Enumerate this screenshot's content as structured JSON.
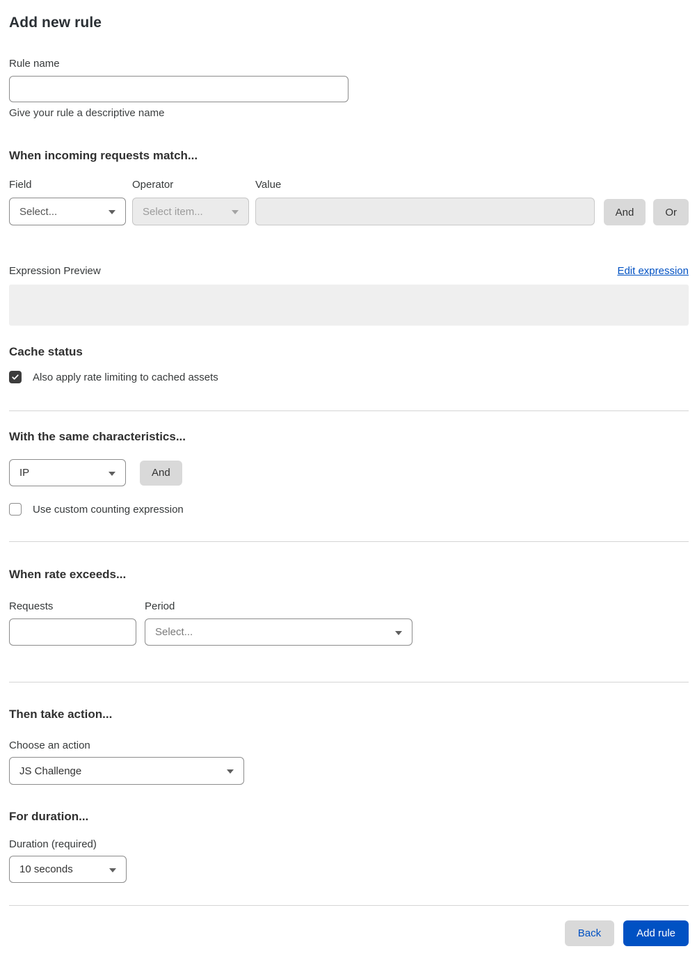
{
  "page": {
    "title": "Add new rule"
  },
  "rule_name": {
    "label": "Rule name",
    "value": "",
    "helper": "Give your rule a descriptive name"
  },
  "match_section": {
    "heading": "When incoming requests match...",
    "field": {
      "label": "Field",
      "selected": "Select..."
    },
    "operator": {
      "label": "Operator",
      "selected": "Select item...",
      "disabled": true
    },
    "value": {
      "label": "Value",
      "value": "",
      "disabled": true
    },
    "and_button": "And",
    "or_button": "Or"
  },
  "expression": {
    "preview_label": "Expression Preview",
    "edit_link": "Edit expression",
    "preview_value": ""
  },
  "cache_status": {
    "heading": "Cache status",
    "checkbox_label": "Also apply rate limiting to cached assets",
    "checked": true
  },
  "characteristics": {
    "heading": "With the same characteristics...",
    "select_value": "IP",
    "and_button": "And",
    "checkbox_label": "Use custom counting expression",
    "checked": false
  },
  "rate": {
    "heading": "When rate exceeds...",
    "requests": {
      "label": "Requests",
      "value": ""
    },
    "period": {
      "label": "Period",
      "selected": "Select..."
    }
  },
  "action": {
    "heading": "Then take action...",
    "label": "Choose an action",
    "selected": "JS Challenge"
  },
  "duration": {
    "heading": "For duration...",
    "label": "Duration (required)",
    "selected": "10 seconds"
  },
  "footer": {
    "back_button": "Back",
    "add_rule_button": "Add rule"
  },
  "icons": {
    "dropdown_caret": "chevron-down",
    "checkmark": "check"
  },
  "colors": {
    "accent_blue": "#0051c3",
    "checked_checkbox": "#3d3d3d",
    "disabled_bg": "#ebebeb",
    "gray_button_bg": "#d9d9d9",
    "preview_box_bg": "#efefef",
    "divider": "#d5d5d5",
    "input_border": "#8c8c8c",
    "heading_text": "#313131"
  }
}
